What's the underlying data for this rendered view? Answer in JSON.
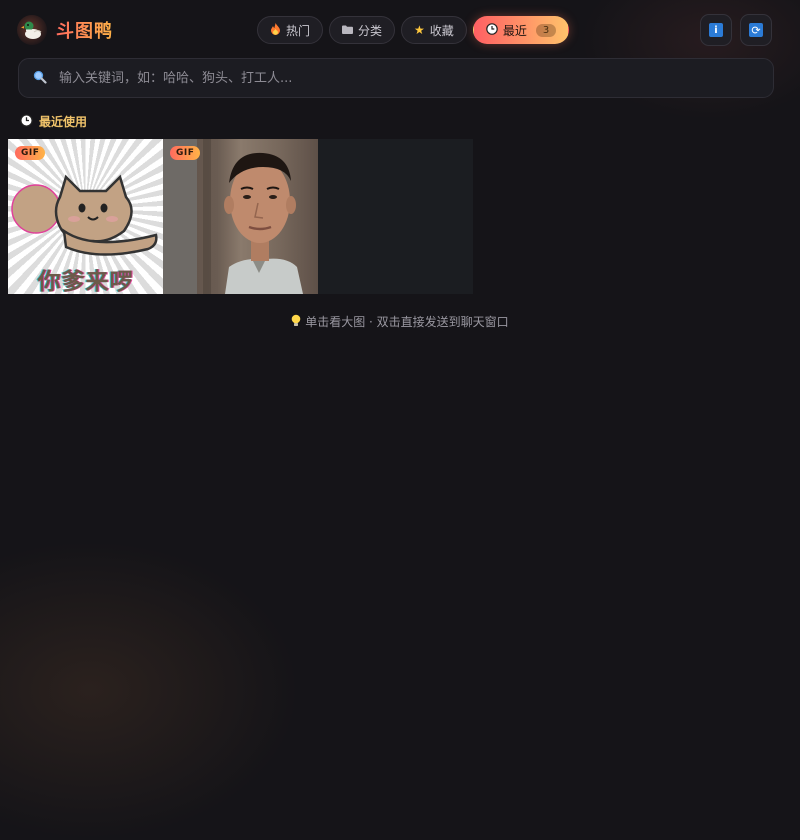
{
  "app": {
    "title": "斗图鸭",
    "logo_icon": "duck-icon"
  },
  "tabs": [
    {
      "id": "hot",
      "icon": "fire-icon",
      "label": "热门",
      "active": false
    },
    {
      "id": "category",
      "icon": "folder-icon",
      "label": "分类",
      "active": false
    },
    {
      "id": "favorites",
      "icon": "star-icon",
      "label": "收藏",
      "active": false
    },
    {
      "id": "recent",
      "icon": "clock-icon",
      "label": "最近",
      "count": "3",
      "active": true
    }
  ],
  "header_buttons": [
    {
      "id": "info",
      "icon": "info-icon",
      "glyph": "i"
    },
    {
      "id": "refresh",
      "icon": "refresh-icon",
      "glyph": "⟳"
    }
  ],
  "search": {
    "placeholder": "输入关键词，如：哈哈、狗头、打工人...",
    "value": ""
  },
  "recent_section": {
    "title": "最近使用",
    "items": [
      {
        "badge": "GIF",
        "caption": "你爹来啰",
        "type": "cartoon-cat"
      },
      {
        "badge": "GIF",
        "type": "man-photo"
      }
    ]
  },
  "hint": {
    "text": "单击看大图 · 双击直接发送到聊天窗口",
    "icon": "bulb-icon"
  },
  "colors": {
    "accent_start": "#ff5f63",
    "accent_end": "#ffc26b",
    "background": "#151418",
    "section_title": "#f0c36a"
  }
}
